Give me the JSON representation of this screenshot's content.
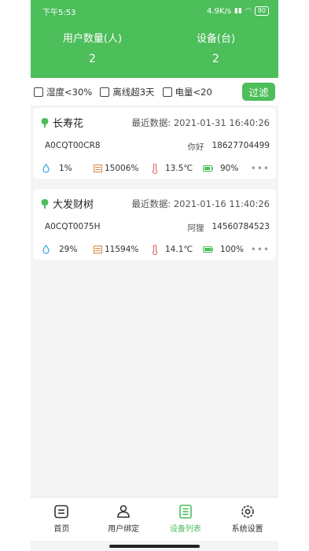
{
  "status": {
    "time": "下午5:53",
    "speed": "4.9K/s",
    "battery": "80"
  },
  "stats": {
    "users_label": "用户数量(人)",
    "users_value": "2",
    "devices_label": "设备(台)",
    "devices_value": "2"
  },
  "filters": {
    "humidity": "湿度<30%",
    "offline": "离线超3天",
    "power": "电量<20",
    "button": "过滤"
  },
  "devices": [
    {
      "name": "长寿花",
      "recent": "最近数据: 2021-01-31 16:40:26",
      "code": "A0CQT00CR8",
      "user": "你好",
      "phone": "18627704499",
      "humidity": "1%",
      "light": "15006%",
      "temp": "13.5℃",
      "battery": "90%",
      "more": "•••"
    },
    {
      "name": "大发财树",
      "recent": "最近数据: 2021-01-16 11:40:26",
      "code": "A0CQT0075H",
      "user": "阿狸",
      "phone": "14560784523",
      "humidity": "29%",
      "light": "11594%",
      "temp": "14.1℃",
      "battery": "100%",
      "more": "•••"
    }
  ],
  "nav": {
    "home": "首页",
    "bind": "用户绑定",
    "list": "设备列表",
    "settings": "系统设置"
  },
  "colors": {
    "brand": "#4cbe5a"
  }
}
